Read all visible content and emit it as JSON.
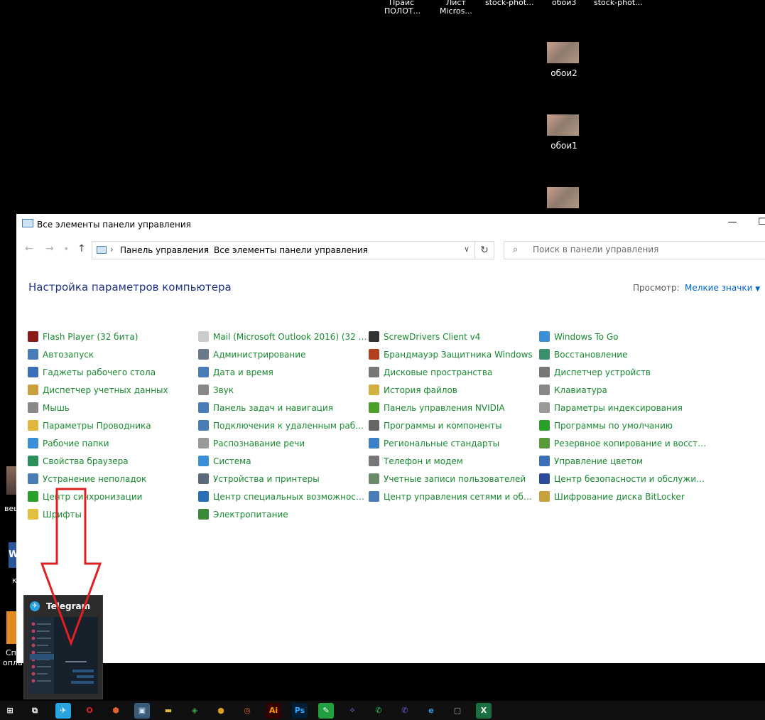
{
  "desktop": {
    "top_fragments": [
      "Прайс",
      "ПОЛОТ...",
      "Лист",
      "Micros...",
      "stock-phot...",
      "обои3",
      "stock-phot..."
    ],
    "icons": [
      {
        "label": "обои2"
      },
      {
        "label": "обои1"
      }
    ],
    "left_fragments": [
      "веш",
      "Сп",
      "опла",
      "к"
    ]
  },
  "window": {
    "title": "Все элементы панели управления",
    "minimize": "—",
    "maximize": "☐",
    "address": {
      "crumbs": [
        "Панель управления",
        "Все элементы панели управления"
      ],
      "separator": "›"
    },
    "search": {
      "placeholder": "Поиск в панели управления"
    },
    "heading": "Настройка параметров компьютера",
    "view_label": "Просмотр:",
    "view_value": "Мелкие значки",
    "columns": [
      [
        {
          "label": "Flash Player (32 бита)",
          "color": "#8b1a1a"
        },
        {
          "label": "Автозапуск",
          "color": "#4a7db5"
        },
        {
          "label": "Гаджеты рабочего стола",
          "color": "#3b6fb6"
        },
        {
          "label": "Диспетчер учетных данных",
          "color": "#c8a040"
        },
        {
          "label": "Мышь",
          "color": "#888888"
        },
        {
          "label": "Параметры Проводника",
          "color": "#e0b840"
        },
        {
          "label": "Рабочие папки",
          "color": "#3b8fd6"
        },
        {
          "label": "Свойства браузера",
          "color": "#2a8f5a"
        },
        {
          "label": "Устранение неполадок",
          "color": "#4a7db5"
        },
        {
          "label": "Центр синхронизации",
          "color": "#2aa02a"
        },
        {
          "label": "Шрифты",
          "color": "#e0c040"
        }
      ],
      [
        {
          "label": "Mail (Microsoft Outlook 2016) (32 би...",
          "color": "#cccccc"
        },
        {
          "label": "Администрирование",
          "color": "#6a7a8a"
        },
        {
          "label": "Дата и время",
          "color": "#4a7db5"
        },
        {
          "label": "Звук",
          "color": "#888888"
        },
        {
          "label": "Панель задач и навигация",
          "color": "#4a7db5"
        },
        {
          "label": "Подключения к удаленным рабоч...",
          "color": "#4a7db5"
        },
        {
          "label": "Распознавание речи",
          "color": "#999999"
        },
        {
          "label": "Система",
          "color": "#3b8fd6"
        },
        {
          "label": "Устройства и принтеры",
          "color": "#5a6a7a"
        },
        {
          "label": "Центр специальных возможностей",
          "color": "#2a6fb6"
        },
        {
          "label": "Электропитание",
          "color": "#3a8a3a"
        }
      ],
      [
        {
          "label": "ScrewDrivers Client v4",
          "color": "#333333"
        },
        {
          "label": "Брандмауэр Защитника Windows",
          "color": "#b04020"
        },
        {
          "label": "Дисковые пространства",
          "color": "#777777"
        },
        {
          "label": "История файлов",
          "color": "#d0b040"
        },
        {
          "label": "Панель управления NVIDIA",
          "color": "#4aa02a"
        },
        {
          "label": "Программы и компоненты",
          "color": "#666666"
        },
        {
          "label": "Региональные стандарты",
          "color": "#3b7fc6"
        },
        {
          "label": "Телефон и модем",
          "color": "#777777"
        },
        {
          "label": "Учетные записи пользователей",
          "color": "#6a8a6a"
        },
        {
          "label": "Центр управления сетями и общи...",
          "color": "#4a7db5"
        }
      ],
      [
        {
          "label": "Windows To Go",
          "color": "#3b8fd6"
        },
        {
          "label": "Восстановление",
          "color": "#3b8f6a"
        },
        {
          "label": "Диспетчер устройств",
          "color": "#777777"
        },
        {
          "label": "Клавиатура",
          "color": "#888888"
        },
        {
          "label": "Параметры индексирования",
          "color": "#999999"
        },
        {
          "label": "Программы по умолчанию",
          "color": "#2aa02a"
        },
        {
          "label": "Резервное копирование и восстан...",
          "color": "#5a9a3a"
        },
        {
          "label": "Управление цветом",
          "color": "#3b6fb6"
        },
        {
          "label": "Центр безопасности и обслуживан...",
          "color": "#2a4a9a"
        },
        {
          "label": "Шифрование диска BitLocker",
          "color": "#c8a040"
        }
      ]
    ]
  },
  "telegram_preview": {
    "title": "Telegram"
  },
  "taskbar": {
    "items": [
      {
        "name": "start-button",
        "glyph": "⊞",
        "bg": "#101010",
        "fg": "#ffffff"
      },
      {
        "name": "task-view-button",
        "glyph": "⧉",
        "bg": "#101010",
        "fg": "#ffffff"
      },
      {
        "name": "taskbar-telegram",
        "glyph": "✈",
        "bg": "#2aa4e0",
        "fg": "#ffffff"
      },
      {
        "name": "taskbar-opera",
        "glyph": "O",
        "bg": "#101010",
        "fg": "#e0202a"
      },
      {
        "name": "taskbar-app-orange",
        "glyph": "⬢",
        "bg": "#101010",
        "fg": "#e06030"
      },
      {
        "name": "taskbar-control-panel",
        "glyph": "▣",
        "bg": "#3a5a7a",
        "fg": "#cfe4f7"
      },
      {
        "name": "taskbar-explorer",
        "glyph": "▬",
        "bg": "#101010",
        "fg": "#e0b840"
      },
      {
        "name": "taskbar-app-green",
        "glyph": "◈",
        "bg": "#101010",
        "fg": "#40a040"
      },
      {
        "name": "taskbar-app-yellow",
        "glyph": "●",
        "bg": "#101010",
        "fg": "#e0a020"
      },
      {
        "name": "taskbar-app-shield",
        "glyph": "◎",
        "bg": "#101010",
        "fg": "#e06020"
      },
      {
        "name": "taskbar-illustrator",
        "glyph": "Ai",
        "bg": "#330000",
        "fg": "#ff9a00"
      },
      {
        "name": "taskbar-photoshop",
        "glyph": "Ps",
        "bg": "#001e36",
        "fg": "#31a8ff"
      },
      {
        "name": "taskbar-app-green-pen",
        "glyph": "✎",
        "bg": "#20a040",
        "fg": "#ffffff"
      },
      {
        "name": "taskbar-app-blue",
        "glyph": "✧",
        "bg": "#101010",
        "fg": "#6a8ad6"
      },
      {
        "name": "taskbar-whatsapp",
        "glyph": "✆",
        "bg": "#101010",
        "fg": "#25d366"
      },
      {
        "name": "taskbar-viber",
        "glyph": "✆",
        "bg": "#101010",
        "fg": "#7360f2"
      },
      {
        "name": "taskbar-edge",
        "glyph": "e",
        "bg": "#101010",
        "fg": "#2aa0e0"
      },
      {
        "name": "taskbar-app-computer",
        "glyph": "▢",
        "bg": "#101010",
        "fg": "#aaaaaa"
      },
      {
        "name": "taskbar-excel",
        "glyph": "X",
        "bg": "#1d6f42",
        "fg": "#ffffff"
      }
    ]
  }
}
